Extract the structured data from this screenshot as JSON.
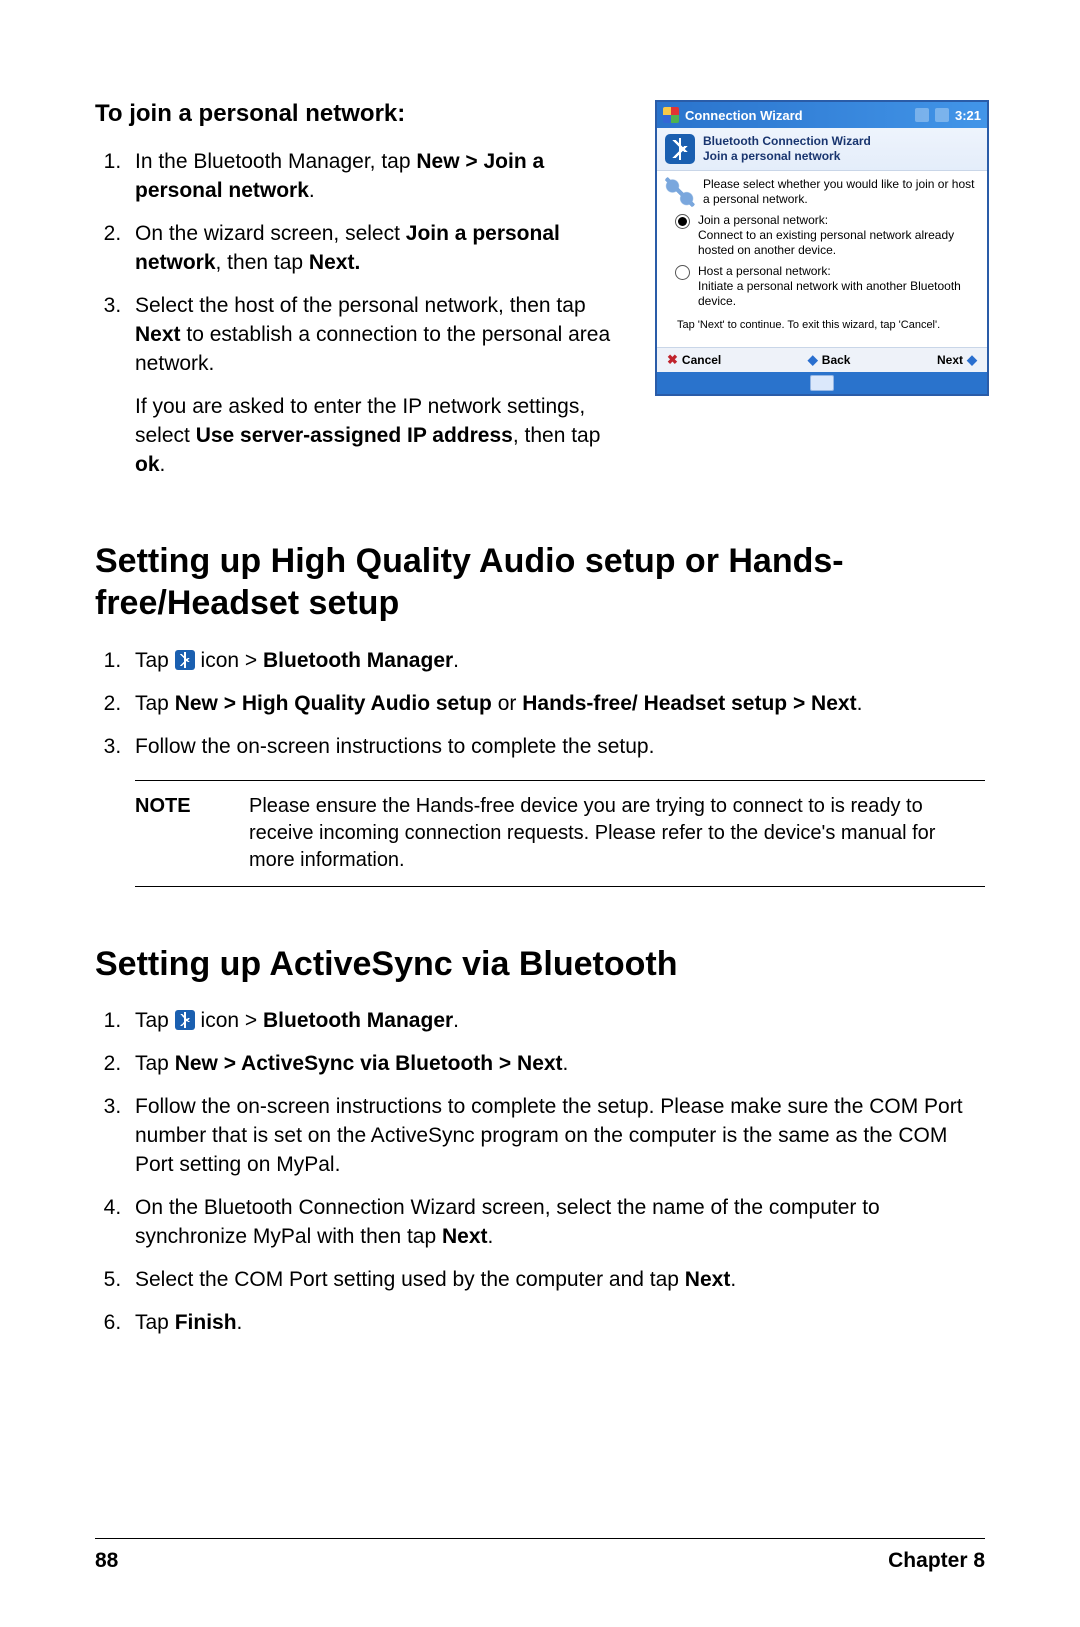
{
  "section1": {
    "heading": "To join a personal network:",
    "steps": [
      {
        "pre": "In the Bluetooth Manager, tap ",
        "b1": "New > Join a personal network",
        "post": "."
      },
      {
        "pre": "On the wizard screen, select ",
        "b1": "Join a personal network",
        "mid": ", then tap ",
        "b2": "Next."
      },
      {
        "pre": "Select the host of the personal network, then tap ",
        "b1": "Next",
        "post": " to establish a connection to the personal area network."
      }
    ],
    "followup": {
      "pre": "If you are asked to enter the IP network settings, select ",
      "b1": "Use server-assigned IP address",
      "mid": ", then tap ",
      "b2": "ok",
      "post": "."
    }
  },
  "wizard": {
    "titlebar": {
      "title": "Connection Wizard",
      "time": "3:21"
    },
    "header": {
      "line1": "Bluetooth Connection Wizard",
      "line2": "Join a personal network"
    },
    "lead": "Please select whether you would like to join or host a personal network.",
    "opt1": {
      "title": "Join a personal network:",
      "desc": "Connect to an existing personal network already hosted on another device."
    },
    "opt2": {
      "title": "Host a personal network:",
      "desc": "Initiate a personal network with another Bluetooth device."
    },
    "hint": "Tap 'Next' to continue. To exit this wizard, tap 'Cancel'.",
    "buttons": {
      "cancel": "Cancel",
      "back": "Back",
      "next": "Next"
    }
  },
  "section2": {
    "heading": "Setting up High Quality Audio setup or Hands-free/Headset setup",
    "steps": {
      "s1": {
        "pre": "Tap ",
        "post1": " icon > ",
        "b1": "Bluetooth Manager",
        "post2": "."
      },
      "s2": {
        "pre": "Tap ",
        "b1": "New > High Quality Audio setup",
        "mid": " or ",
        "b2": "Hands-free/ Headset setup > Next",
        "post": "."
      },
      "s3": "Follow the on-screen instructions to complete the setup."
    },
    "note_label": "NOTE",
    "note_text": "Please ensure the Hands-free device you are trying to connect to is ready to receive incoming connection requests. Please refer to the device's manual for more information."
  },
  "section3": {
    "heading": "Setting up ActiveSync via Bluetooth",
    "steps": {
      "s1": {
        "pre": "Tap ",
        "post1": " icon > ",
        "b1": "Bluetooth Manager",
        "post2": "."
      },
      "s2": {
        "pre": "Tap ",
        "b1": "New > ActiveSync via Bluetooth > Next",
        "post": "."
      },
      "s3": "Follow the on-screen instructions to complete the setup. Please make sure the COM Port number that is set on the ActiveSync program on the computer is the same as the COM Port setting on MyPal.",
      "s4": {
        "pre": "On the Bluetooth Connection Wizard screen, select the name of the computer to synchronize MyPal with then tap ",
        "b1": "Next",
        "post": "."
      },
      "s5": {
        "pre": "Select the COM Port setting used by the computer and tap ",
        "b1": "Next",
        "post": "."
      },
      "s6": {
        "pre": "Tap ",
        "b1": "Finish",
        "post": "."
      }
    }
  },
  "footer": {
    "page": "88",
    "chapter": "Chapter 8"
  }
}
